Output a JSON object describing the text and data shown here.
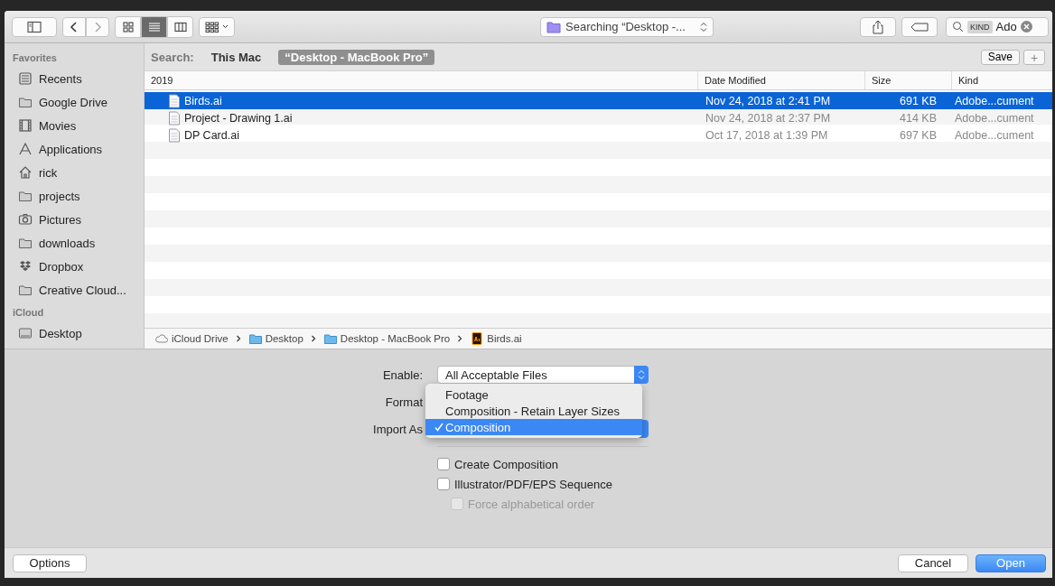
{
  "toolbar": {
    "views": [
      {
        "kind": "icon",
        "selected": false
      },
      {
        "kind": "list",
        "selected": true
      },
      {
        "kind": "column",
        "selected": false
      }
    ],
    "location": "Searching “Desktop -...",
    "search": {
      "token": "KIND",
      "value": "Ado"
    }
  },
  "search_bar": {
    "label": "Search:",
    "scopes": [
      {
        "label": "This Mac",
        "selected": false
      },
      {
        "label": "“Desktop - MacBook Pro”",
        "selected": true
      }
    ],
    "save": "Save",
    "add": "+"
  },
  "sidebar": {
    "sections": [
      {
        "title": "Favorites",
        "items": [
          {
            "label": "Recents",
            "kind": "recents"
          },
          {
            "label": "Google Drive",
            "kind": "folder"
          },
          {
            "label": "Movies",
            "kind": "film"
          },
          {
            "label": "Applications",
            "kind": "apps"
          },
          {
            "label": "rick",
            "kind": "home"
          },
          {
            "label": "projects",
            "kind": "folder"
          },
          {
            "label": "Pictures",
            "kind": "camera"
          },
          {
            "label": "downloads",
            "kind": "folder"
          },
          {
            "label": "Dropbox",
            "kind": "dropbox"
          },
          {
            "label": "Creative Cloud...",
            "kind": "folder"
          }
        ]
      },
      {
        "title": "iCloud",
        "items": [
          {
            "label": "Desktop",
            "kind": "desktop"
          }
        ]
      }
    ]
  },
  "table": {
    "columns": [
      "2019",
      "Date Modified",
      "Size",
      "Kind"
    ],
    "rows": [
      {
        "name": "Birds.ai",
        "date": "Nov 24, 2018 at 2:41 PM",
        "size": "691 KB",
        "kind": "Adobe...cument",
        "selected": true
      },
      {
        "name": "Project - Drawing 1.ai",
        "date": "Nov 24, 2018 at 2:37 PM",
        "size": "414 KB",
        "kind": "Adobe...cument",
        "selected": false
      },
      {
        "name": "DP Card.ai",
        "date": "Oct 17, 2018 at 1:39 PM",
        "size": "697 KB",
        "kind": "Adobe...cument",
        "selected": false
      }
    ]
  },
  "path_bar": [
    {
      "label": "iCloud Drive",
      "kind": "cloud"
    },
    {
      "label": "Desktop",
      "kind": "folder"
    },
    {
      "label": "Desktop - MacBook Pro",
      "kind": "folder"
    },
    {
      "label": "Birds.ai",
      "kind": "ai"
    }
  ],
  "options": {
    "enable": {
      "label": "Enable:",
      "value": "All Acceptable Files"
    },
    "format": {
      "label": "Format"
    },
    "import_as": {
      "label": "Import As"
    },
    "menu": [
      {
        "label": "Footage",
        "selected": false
      },
      {
        "label": "Composition - Retain Layer Sizes",
        "selected": false
      },
      {
        "label": "Composition",
        "selected": true
      }
    ],
    "checkboxes": [
      {
        "label": "Create Composition",
        "checked": false,
        "disabled": false
      },
      {
        "label": "Illustrator/PDF/EPS Sequence",
        "checked": false,
        "disabled": false
      },
      {
        "label": "Force alphabetical order",
        "checked": false,
        "disabled": true
      }
    ]
  },
  "footer": {
    "buttons": [
      {
        "label": "Options",
        "kind": "plain"
      },
      {
        "label": "Cancel",
        "kind": "plain"
      },
      {
        "label": "Open",
        "kind": "default"
      }
    ]
  }
}
